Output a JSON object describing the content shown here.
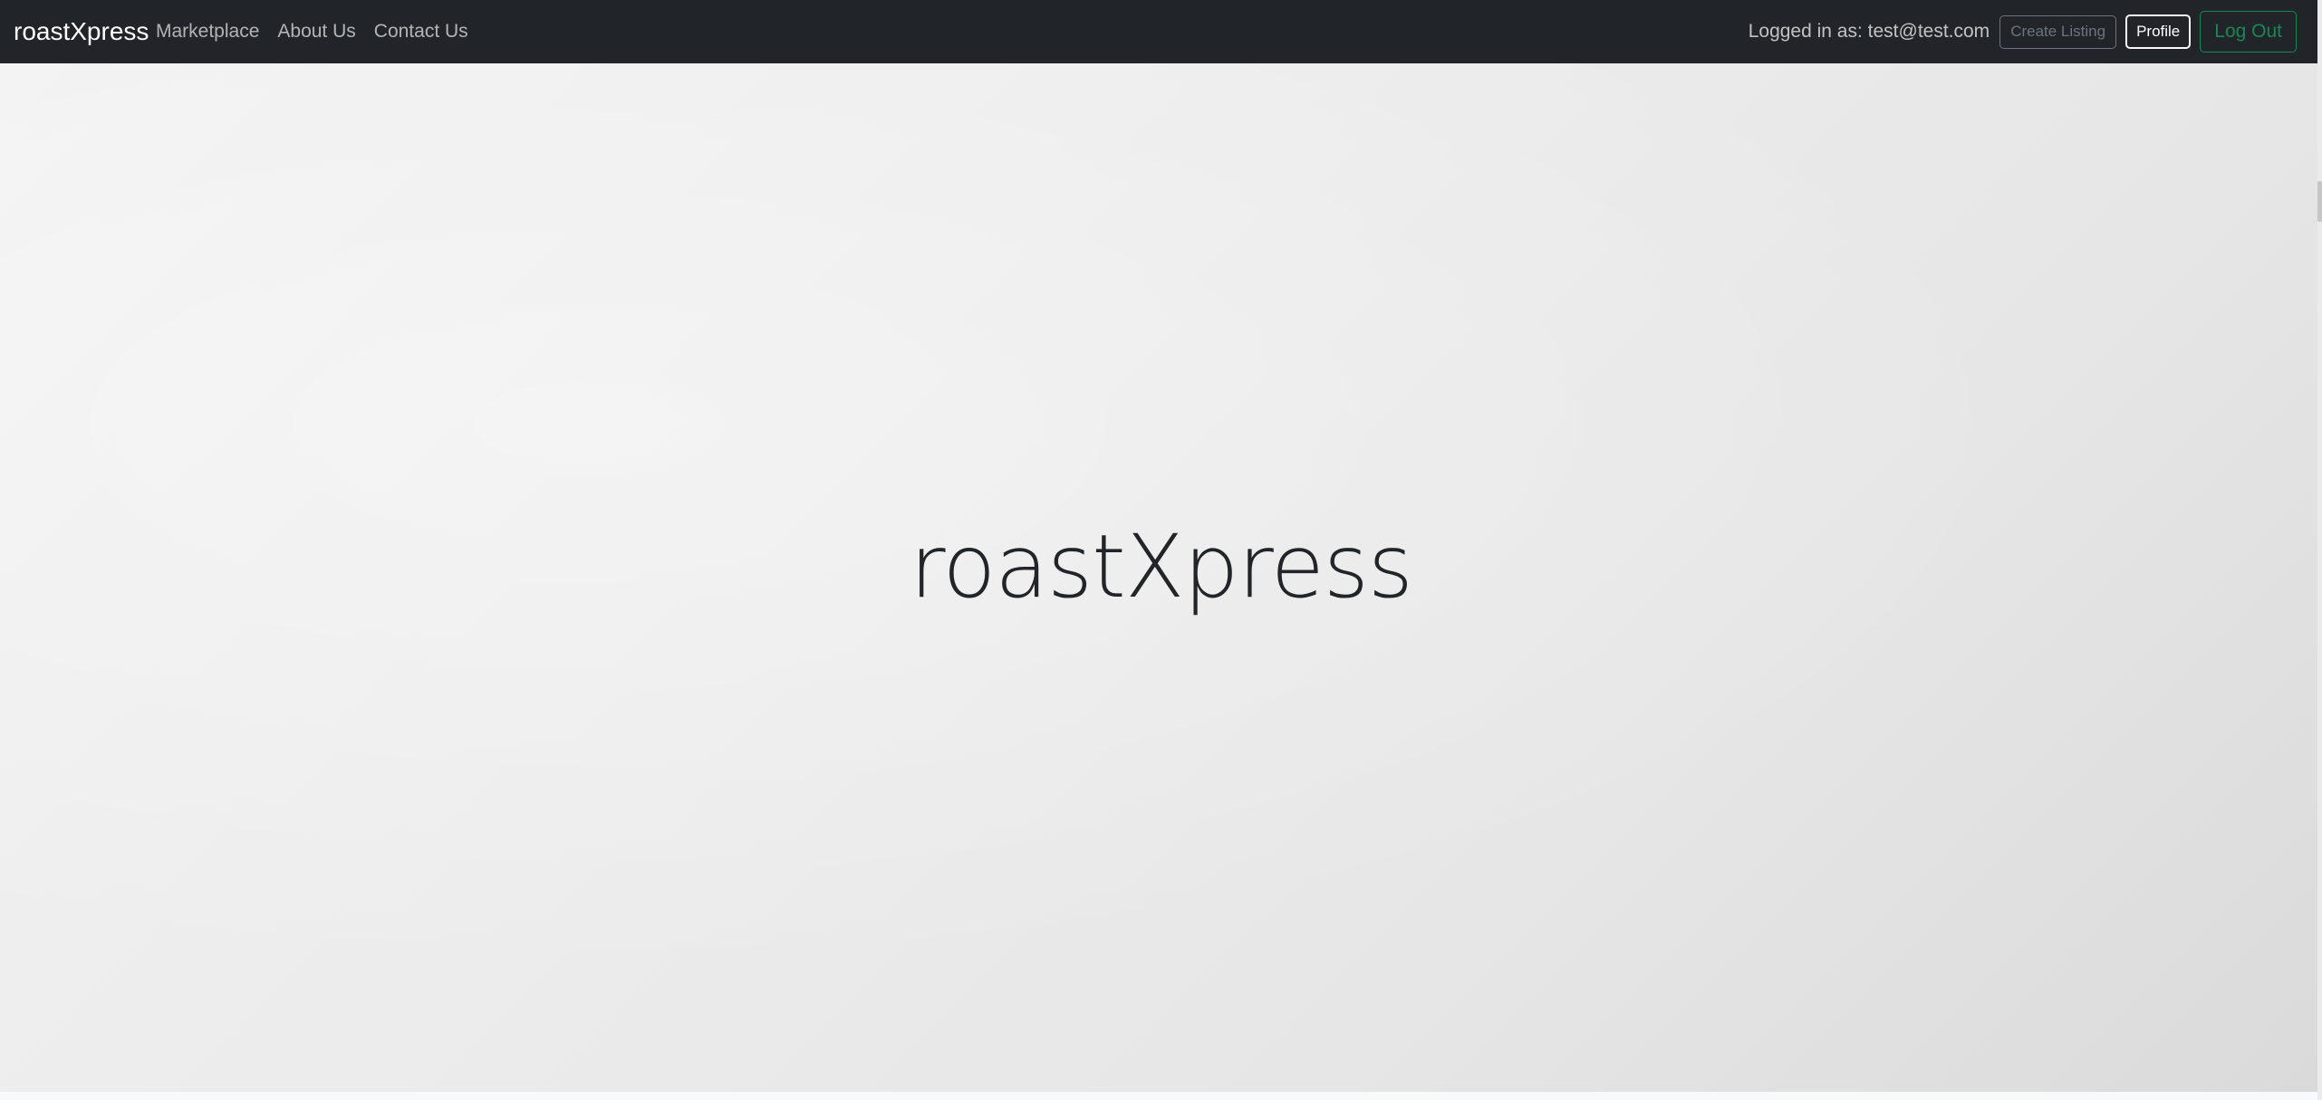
{
  "navbar": {
    "brand": "roastXpress",
    "links": [
      {
        "label": "Marketplace"
      },
      {
        "label": "About Us"
      },
      {
        "label": "Contact Us"
      }
    ],
    "login_text": "Logged in as: test@test.com",
    "create_listing_label": "Create Listing",
    "profile_label": "Profile",
    "logout_label": "Log Out"
  },
  "hero": {
    "title": "roastXpress"
  },
  "colors": {
    "navbar_bg": "#212529",
    "create_listing_border": "#6c757d",
    "logout_green": "#198754",
    "hero_text": "#212529"
  }
}
